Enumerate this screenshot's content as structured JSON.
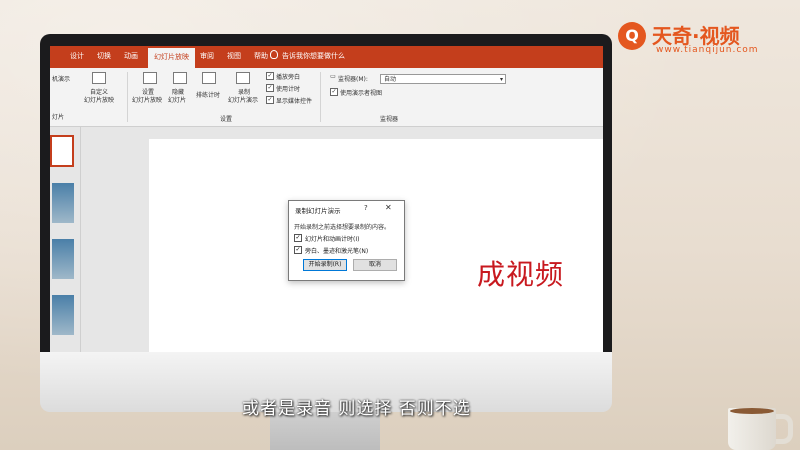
{
  "ribbon": {
    "tabs": [
      "设计",
      "切换",
      "动画",
      "幻灯片放映",
      "审阅",
      "视图",
      "帮助"
    ],
    "active_tab": "幻灯片放映",
    "tell_me": "告诉我你想要做什么",
    "left_fragment_1": "机演示",
    "left_fragment_2": "灯片",
    "custom_show_1": "自定义",
    "custom_show_2": "幻灯片放映",
    "setup_1": "设置",
    "setup_2": "幻灯片放映",
    "hide_1": "隐藏",
    "hide_2": "幻灯片",
    "rehearse": "排练计时",
    "record_1": "录制",
    "record_2": "幻灯片演示",
    "play_narration": "播放旁白",
    "use_timings": "使用计时",
    "show_media_controls": "显示媒体控件",
    "group_setup": "设置",
    "monitor_label": "监视器(M):",
    "monitor_value": "自动",
    "presenter_view": "使用演示者视图",
    "group_monitors": "监视器"
  },
  "slide": {
    "visible_text": "成视频"
  },
  "dialog": {
    "title": "录制幻灯片演示",
    "help": "?",
    "close": "✕",
    "description": "开始录制之前选择想要录制的内容。",
    "option_1": "幻灯片和动画计时(I)",
    "option_2": "旁白、墨迹和激光笔(N)",
    "start_button": "开始录制(R)",
    "cancel_button": "取消"
  },
  "caption": "或者是录音 则选择 否则不选",
  "watermark": {
    "brand": "天奇·视频",
    "url": "www.tianqijun.com"
  },
  "colors": {
    "ribbon_red": "#c43e1c",
    "slide_text_red": "#c8191f",
    "logo_orange": "#e4571f"
  }
}
